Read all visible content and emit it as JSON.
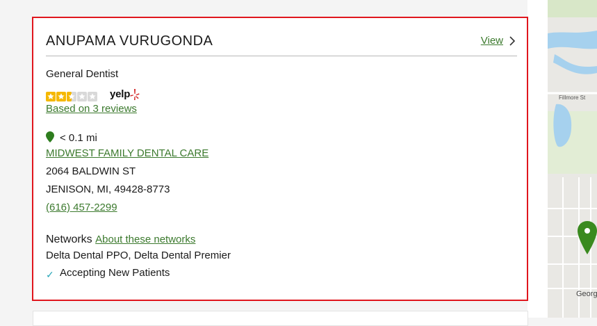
{
  "provider": {
    "name": "ANUPAMA VURUGONDA",
    "view_label": "View",
    "specialty": "General Dentist",
    "rating": {
      "stars": 2.5,
      "max": 5,
      "source": "yelp",
      "reviews_label": "Based on 3 reviews"
    },
    "distance": "< 0.1 mi",
    "practice_name": "MIDWEST FAMILY DENTAL CARE",
    "address_line1": "2064 BALDWIN ST",
    "address_line2": "JENISON, MI, 49428-8773",
    "phone": "(616) 457-2299",
    "networks_label": "Networks",
    "networks_link": "About these networks",
    "networks_list": "Delta Dental PPO, Delta Dental Premier",
    "accepting_label": "Accepting New Patients"
  },
  "map": {
    "street_labels": [
      "Fillmore St",
      "Georg"
    ],
    "marker_color": "#3a8a1f"
  },
  "colors": {
    "highlight_border": "#e0161d",
    "link": "#3c7a2e",
    "star": "#f5b800",
    "yelp_burst": "#d32323",
    "check": "#2aa7b8"
  },
  "icons": [
    "chevron-right-icon",
    "star-icon",
    "yelp-burst-icon",
    "location-pin-icon",
    "checkmark-icon",
    "map-marker-icon"
  ]
}
